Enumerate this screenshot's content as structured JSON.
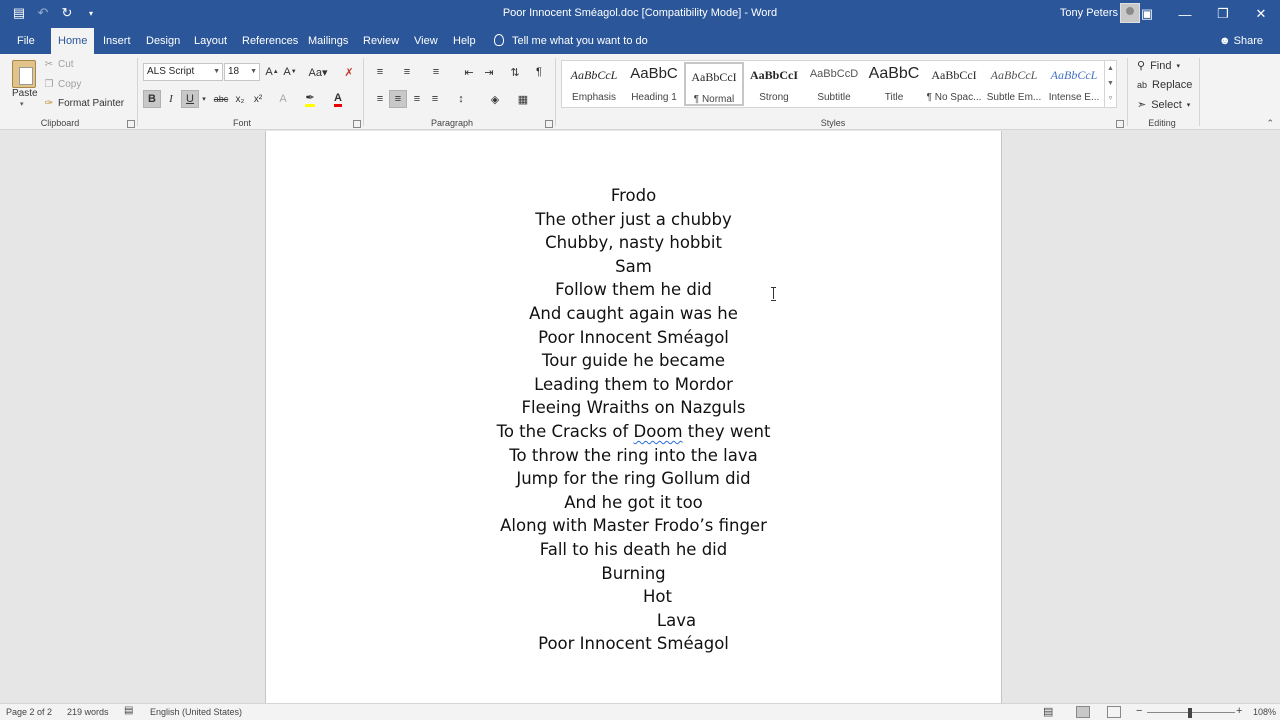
{
  "window": {
    "title": "Poor Innocent Sméagol.doc [Compatibility Mode]  -  Word",
    "user": "Tony Peters"
  },
  "tabs": [
    "File",
    "Home",
    "Insert",
    "Design",
    "Layout",
    "References",
    "Mailings",
    "Review",
    "View",
    "Help"
  ],
  "active_tab": "Home",
  "tell_me": "Tell me what you want to do",
  "share": "Share",
  "clipboard": {
    "paste": "Paste",
    "cut": "Cut",
    "copy": "Copy",
    "format_painter": "Format Painter",
    "label": "Clipboard"
  },
  "font": {
    "name": "ALS Script",
    "size": "18",
    "label": "Font",
    "bold": "B",
    "italic": "I",
    "underline": "U",
    "strike": "abc",
    "subscript": "x₂",
    "superscript": "x²"
  },
  "paragraph": {
    "label": "Paragraph"
  },
  "styles": {
    "label": "Styles",
    "items": [
      {
        "preview": "AaBbCcL",
        "name": "Emphasis"
      },
      {
        "preview": "AaBbC",
        "name": "Heading 1"
      },
      {
        "preview": "AaBbCcI",
        "name": "¶ Normal"
      },
      {
        "preview": "AaBbCcI",
        "name": "Strong"
      },
      {
        "preview": "AaBbCcD",
        "name": "Subtitle"
      },
      {
        "preview": "AaBbC",
        "name": "Title"
      },
      {
        "preview": "AaBbCcI",
        "name": "¶ No Spac..."
      },
      {
        "preview": "AaBbCcL",
        "name": "Subtle Em..."
      },
      {
        "preview": "AaBbCcL",
        "name": "Intense E..."
      }
    ]
  },
  "editing": {
    "label": "Editing",
    "find": "Find",
    "replace": "Replace",
    "select": "Select"
  },
  "document": {
    "lines": [
      "Frodo",
      "The other just a chubby",
      "Chubby, nasty hobbit",
      "Sam",
      "Follow them he did",
      "And caught again was he",
      "Poor Innocent Sméagol",
      "Tour guide he became",
      "Leading them to Mordor",
      "Fleeing Wraiths on Nazguls",
      "To the Cracks of ",
      "To throw the ring into the lava",
      "Jump for the ring Gollum did",
      "And he got it too",
      "Along with Master Frodo’s finger",
      "Fall to his death he did",
      "Burning",
      "Hot",
      "Lava",
      "Poor Innocent Sméagol"
    ],
    "line11_misspelled": "Doom",
    "line11_tail": " they went"
  },
  "status": {
    "page": "Page 2 of 2",
    "words": "219 words",
    "language": "English (United States)",
    "zoom": "108%",
    "zoom_minus": "−",
    "zoom_plus": "+"
  },
  "colors": {
    "brand": "#2b579a",
    "ribbon": "#f3f3f3",
    "canvas": "#e6e6e6"
  }
}
